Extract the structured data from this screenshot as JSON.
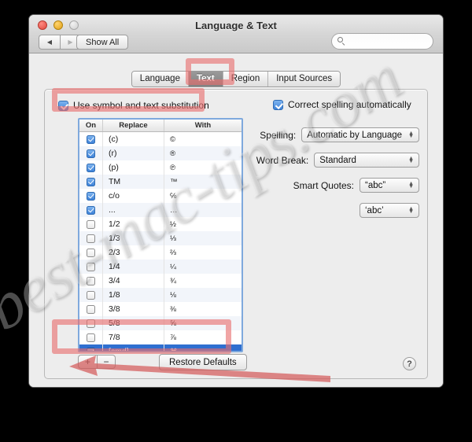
{
  "window": {
    "title": "Language & Text",
    "controls": {
      "close": "close-button",
      "minimize": "minimize-button",
      "zoom": "zoom-button"
    },
    "back_glyph": "◀",
    "forward_glyph": "▶",
    "show_all_label": "Show All",
    "search": {
      "value": "",
      "placeholder": ""
    }
  },
  "tabs": [
    {
      "label": "Language",
      "selected": false
    },
    {
      "label": "Text",
      "selected": true
    },
    {
      "label": "Region",
      "selected": false
    },
    {
      "label": "Input Sources",
      "selected": false
    }
  ],
  "left": {
    "use_substitution": {
      "label": "Use symbol and text substitution",
      "checked": true
    },
    "table": {
      "columns": [
        "On",
        "Replace",
        "With"
      ],
      "rows": [
        {
          "on": true,
          "replace": "(c)",
          "with": "©",
          "selected": false
        },
        {
          "on": true,
          "replace": "(r)",
          "with": "®",
          "selected": false
        },
        {
          "on": true,
          "replace": "(p)",
          "with": "℗",
          "selected": false
        },
        {
          "on": true,
          "replace": "TM",
          "with": "™",
          "selected": false
        },
        {
          "on": true,
          "replace": "c/o",
          "with": "℅",
          "selected": false
        },
        {
          "on": true,
          "replace": "...",
          "with": "…",
          "selected": false
        },
        {
          "on": false,
          "replace": "1/2",
          "with": "½",
          "selected": false
        },
        {
          "on": false,
          "replace": "1/3",
          "with": "⅓",
          "selected": false
        },
        {
          "on": false,
          "replace": "2/3",
          "with": "⅔",
          "selected": false
        },
        {
          "on": false,
          "replace": "1/4",
          "with": "¼",
          "selected": false
        },
        {
          "on": false,
          "replace": "3/4",
          "with": "¾",
          "selected": false
        },
        {
          "on": false,
          "replace": "1/8",
          "with": "⅛",
          "selected": false
        },
        {
          "on": false,
          "replace": "3/8",
          "with": "⅜",
          "selected": false
        },
        {
          "on": false,
          "replace": "5/8",
          "with": "⅝",
          "selected": false
        },
        {
          "on": false,
          "replace": "7/8",
          "with": "⅞",
          "selected": false
        },
        {
          "on": true,
          "replace": "[cmd]",
          "with": "⌘",
          "selected": true
        }
      ]
    },
    "add_label": "+",
    "remove_label": "−",
    "restore_defaults_label": "Restore Defaults"
  },
  "right": {
    "correct_spelling": {
      "label": "Correct spelling automatically",
      "checked": true
    },
    "spelling": {
      "label": "Spelling:",
      "value": "Automatic by Language"
    },
    "word_break": {
      "label": "Word Break:",
      "value": "Standard"
    },
    "smart_quotes": {
      "label": "Smart Quotes:",
      "value_double": "“abc”",
      "value_single": "‘abc’"
    }
  },
  "help_label": "?",
  "watermark": {
    "text": "best-mac-tips.com"
  },
  "annotations": {
    "accent_color": "#e86e6e",
    "boxes": [
      "text-tab",
      "use-symbol-checkbox",
      "cmd-row"
    ],
    "arrow": "points to add-remove buttons"
  }
}
